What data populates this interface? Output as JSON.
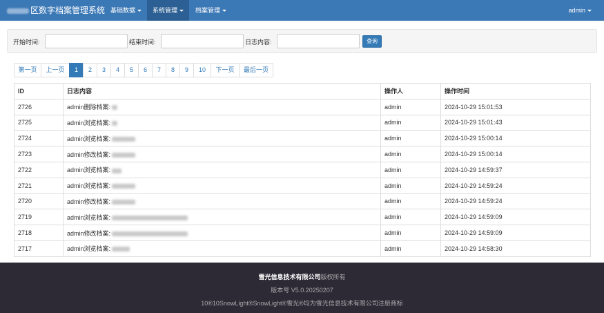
{
  "navbar": {
    "brand": "区数字档案管理系统",
    "menus": [
      {
        "label": "基础数据"
      },
      {
        "label": "系统管理"
      },
      {
        "label": "档案管理"
      }
    ],
    "user": "admin"
  },
  "filter": {
    "start_label": "开始时间:",
    "end_label": "结束时间:",
    "content_label": "日志内容:",
    "query_label": "查询"
  },
  "pagination": {
    "first": "第一页",
    "prev": "上一页",
    "pages": [
      "1",
      "2",
      "3",
      "4",
      "5",
      "6",
      "7",
      "8",
      "9",
      "10"
    ],
    "current_page": "1",
    "next": "下一页",
    "last": "最后一页"
  },
  "table": {
    "headers": {
      "id": "ID",
      "content": "日志内容",
      "operator": "操作人",
      "time": "操作时间"
    },
    "rows": [
      {
        "id": "2726",
        "content": "admin删除档案:",
        "operator": "admin",
        "time": "2024-10-29 15:01:53"
      },
      {
        "id": "2725",
        "content": "admin浏览档案:",
        "operator": "admin",
        "time": "2024-10-29 15:01:43"
      },
      {
        "id": "2724",
        "content": "admin浏览档案:",
        "operator": "admin",
        "time": "2024-10-29 15:00:14"
      },
      {
        "id": "2723",
        "content": "admin修改档案:",
        "operator": "admin",
        "time": "2024-10-29 15:00:14"
      },
      {
        "id": "2722",
        "content": "admin浏览档案:",
        "operator": "admin",
        "time": "2024-10-29 14:59:37"
      },
      {
        "id": "2721",
        "content": "admin浏览档案:",
        "operator": "admin",
        "time": "2024-10-29 14:59:24"
      },
      {
        "id": "2720",
        "content": "admin修改档案:",
        "operator": "admin",
        "time": "2024-10-29 14:59:24"
      },
      {
        "id": "2719",
        "content": "admin浏览档案:",
        "operator": "admin",
        "time": "2024-10-29 14:59:09"
      },
      {
        "id": "2718",
        "content": "admin修改档案:",
        "operator": "admin",
        "time": "2024-10-29 14:59:09"
      },
      {
        "id": "2717",
        "content": "admin浏览档案:",
        "operator": "admin",
        "time": "2024-10-29 14:58:30"
      }
    ]
  },
  "footer": {
    "company": "雪光信息技术有限公司",
    "rights": "版权所有",
    "version": "版本号 V5.0.20250207",
    "trademark": "10®10SnowLight®SnowLight®雪光®均为雪光信息技术有限公司注册商标"
  },
  "colors": {
    "navbar": "#3b78b6",
    "accent": "#337ab7",
    "footer": "#2d2a36"
  }
}
